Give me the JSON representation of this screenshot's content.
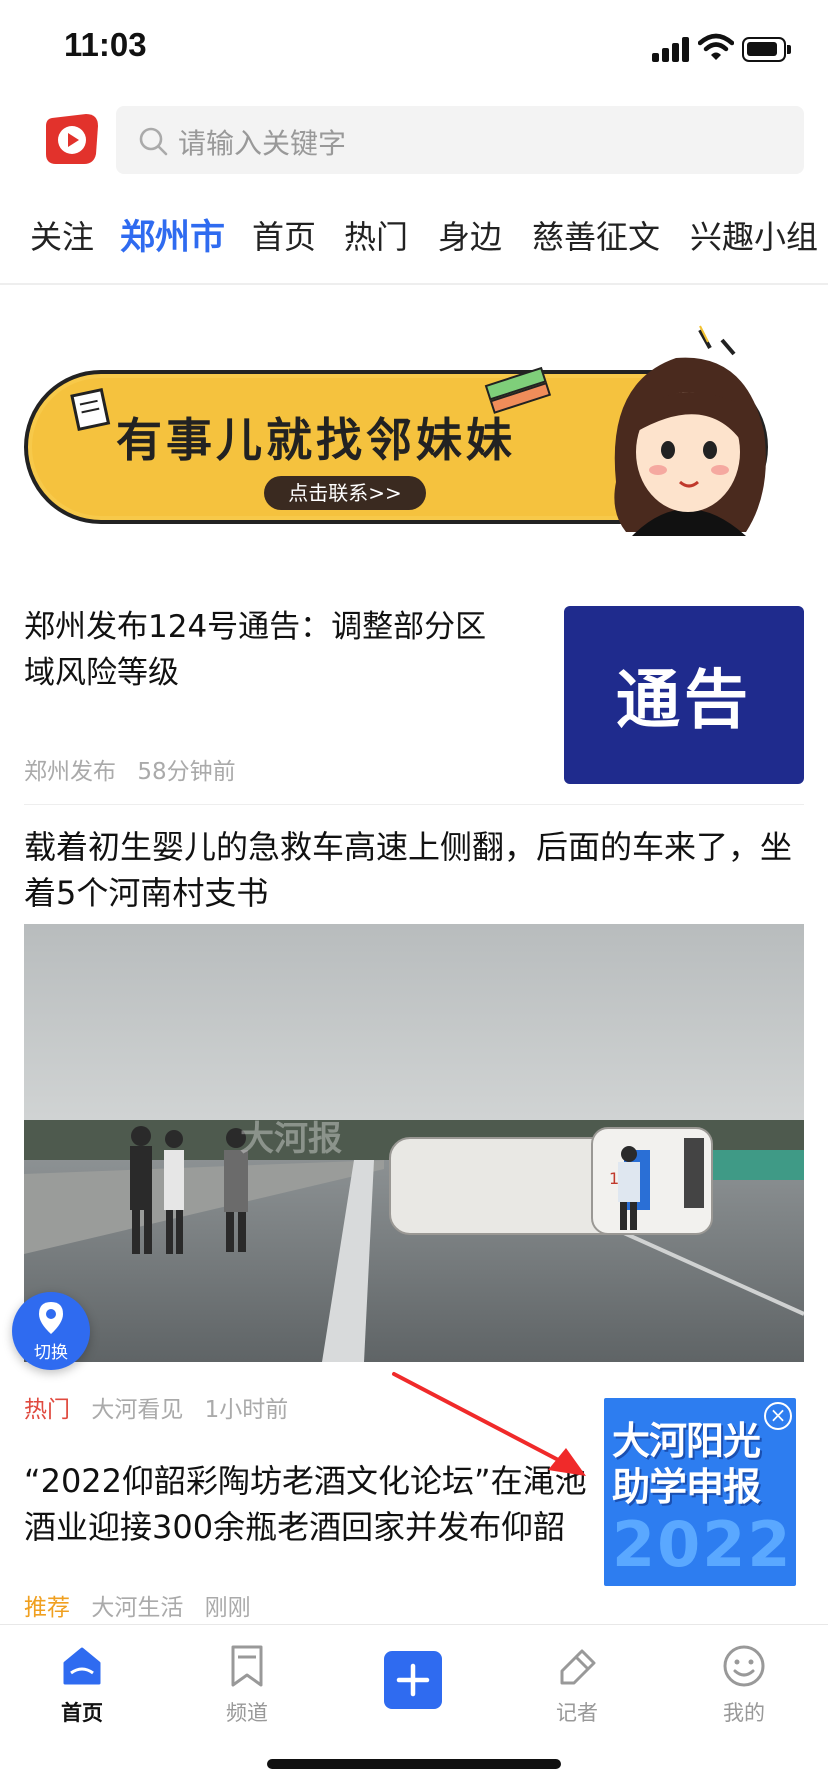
{
  "status_bar": {
    "time": "11:03"
  },
  "search": {
    "placeholder": "请输入关键字"
  },
  "tabs": [
    {
      "label": "关注",
      "active": false
    },
    {
      "label": "郑州市",
      "active": true
    },
    {
      "label": "首页",
      "active": false
    },
    {
      "label": "热门",
      "active": false
    },
    {
      "label": "身边",
      "active": false
    },
    {
      "label": "慈善征文",
      "active": false
    },
    {
      "label": "兴趣小组",
      "active": false
    }
  ],
  "banner": {
    "headline": "有事儿就找邻妹妹",
    "cta": "点击联系>>"
  },
  "articles": [
    {
      "title": "郑州发布124号通告：调整部分区域风险等级",
      "source": "郑州发布",
      "time": "58分钟前",
      "thumb_text": "通告"
    },
    {
      "title": "载着初生婴儿的急救车高速上侧翻，后面的车来了，坐着5个河南村支书",
      "tag": "热门",
      "source": "大河看见",
      "time": "1小时前",
      "image_watermark": "大河报"
    },
    {
      "title_line1": "“2022仰韶彩陶坊老酒文化论坛”在渑池",
      "title_line2": "酒业迎接300余瓶老酒回家并发布仰韶",
      "tag": "推荐",
      "source": "大河生活",
      "time": "刚刚"
    }
  ],
  "location_button": {
    "label": "切换"
  },
  "float_ad": {
    "line1": "大河阳光",
    "line2": "助学申报",
    "year": "2022"
  },
  "bottom_nav": [
    {
      "label": "首页",
      "icon": "home-icon",
      "active": true
    },
    {
      "label": "频道",
      "icon": "bookmark-icon",
      "active": false
    },
    {
      "label": "",
      "icon": "plus-icon",
      "active": false
    },
    {
      "label": "记者",
      "icon": "pen-icon",
      "active": false
    },
    {
      "label": "我的",
      "icon": "smiley-icon",
      "active": false
    }
  ],
  "colors": {
    "accent": "#2f6bf0",
    "hot": "#e04a3f",
    "recommend": "#f0a020",
    "notice_bg": "#1f2b8d"
  }
}
